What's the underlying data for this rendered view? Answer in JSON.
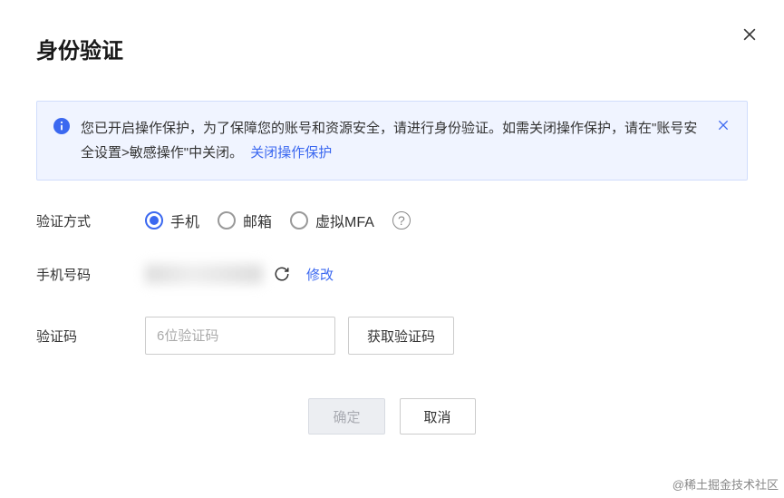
{
  "modal": {
    "title": "身份验证"
  },
  "alert": {
    "text": "您已开启操作保护，为了保障您的账号和资源安全，请进行身份验证。如需关闭操作保护，请在\"账号安全设置>敏感操作\"中关闭。",
    "linkText": "关闭操作保护"
  },
  "form": {
    "methodLabel": "验证方式",
    "methods": {
      "phone": "手机",
      "email": "邮箱",
      "mfa": "虚拟MFA"
    },
    "selectedMethod": "phone",
    "phoneLabel": "手机号码",
    "modifyLink": "修改",
    "codeLabel": "验证码",
    "codePlaceholder": "6位验证码",
    "getCodeButton": "获取验证码"
  },
  "footer": {
    "confirm": "确定",
    "cancel": "取消"
  },
  "watermark": "@稀土掘金技术社区"
}
